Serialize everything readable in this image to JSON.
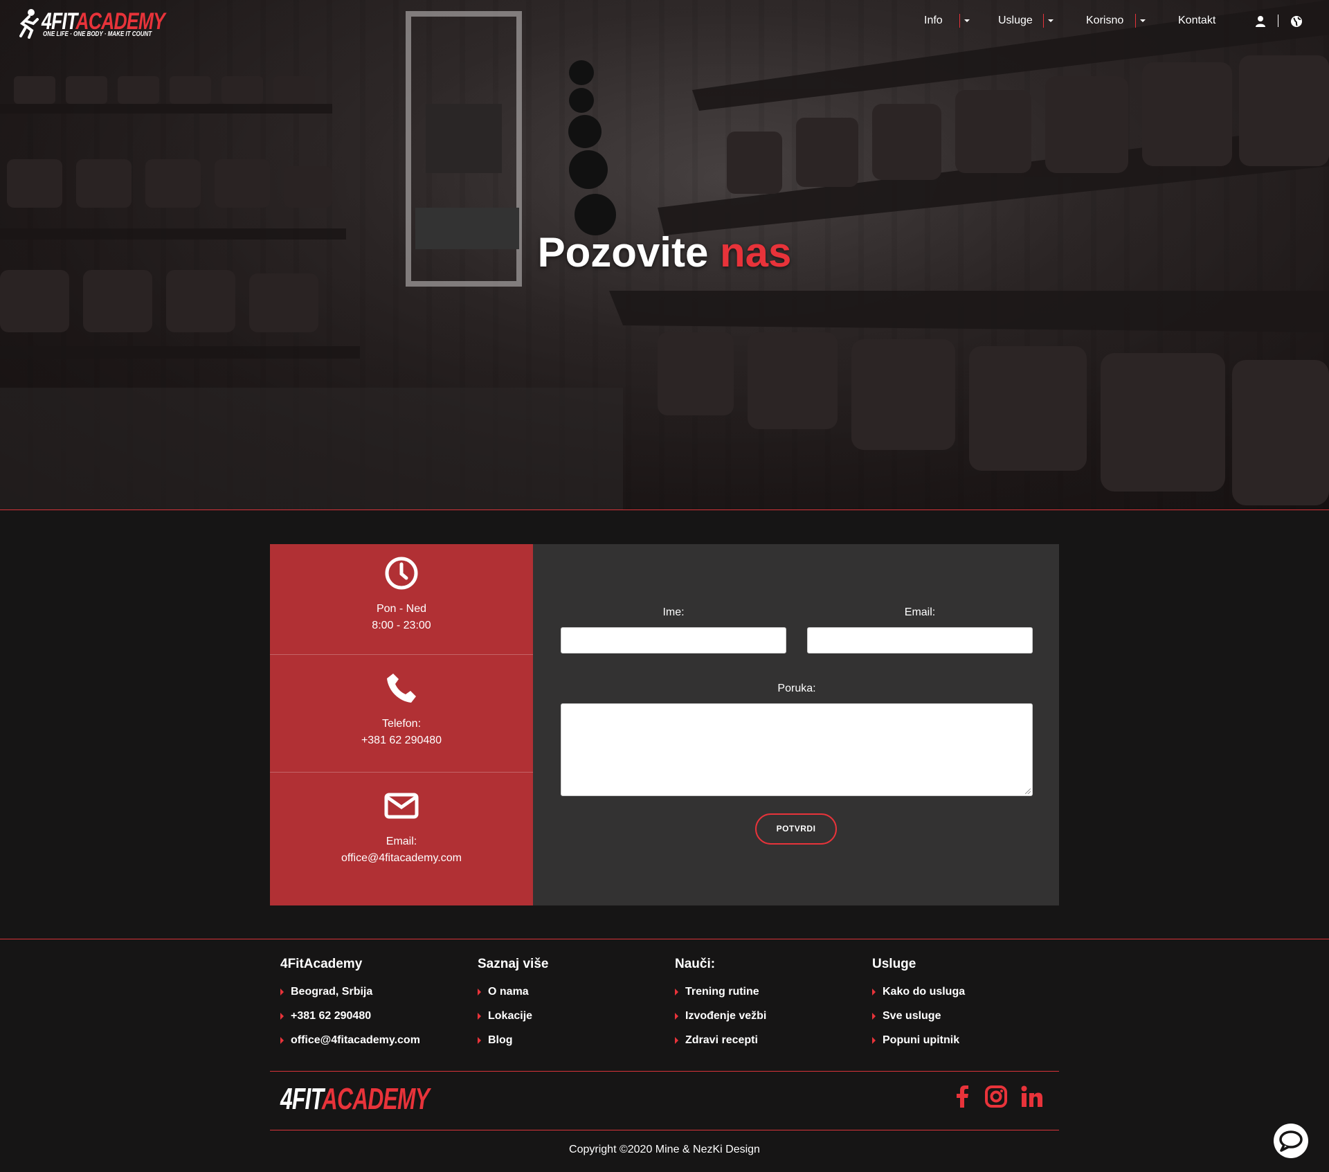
{
  "brand": {
    "logo_white": "4FIT",
    "logo_red": "ACADEMY",
    "tagline": "ONE LIFE · ONE BODY · MAKE IT COUNT"
  },
  "nav": {
    "items": [
      {
        "label": "Info",
        "has_dropdown": true
      },
      {
        "label": "Usluge",
        "has_dropdown": true
      },
      {
        "label": "Korisno",
        "has_dropdown": true
      },
      {
        "label": "Kontakt",
        "has_dropdown": false
      }
    ],
    "icons": [
      "user-icon",
      "globe-icon"
    ]
  },
  "hero": {
    "title_main": "Pozovite",
    "title_accent": "nas"
  },
  "contact_info": {
    "hours": {
      "icon": "clock-icon",
      "line1": "Pon - Ned",
      "line2": "8:00 - 23:00"
    },
    "phone": {
      "icon": "phone-icon",
      "line1": "Telefon:",
      "line2": "+381 62 290480"
    },
    "email": {
      "icon": "envelope-icon",
      "line1": "Email:",
      "line2": "office@4fitacademy.com"
    }
  },
  "form": {
    "name_label": "Ime:",
    "name_value": "",
    "email_label": "Email:",
    "email_value": "",
    "message_label": "Poruka:",
    "message_value": "",
    "submit_label": "POTVRDI"
  },
  "footer": {
    "columns": [
      {
        "title": "4FitAcademy",
        "items": [
          "Beograd, Srbija",
          "+381 62 290480",
          "office@4fitacademy.com"
        ]
      },
      {
        "title": "Saznaj više",
        "items": [
          "O nama",
          "Lokacije",
          "Blog"
        ]
      },
      {
        "title": "Nauči:",
        "items": [
          "Trening rutine",
          "Izvođenje vežbi",
          "Zdravi recepti"
        ]
      },
      {
        "title": "Usluge",
        "items": [
          "Kako do usluga",
          "Sve usluge",
          "Popuni upitnik"
        ]
      }
    ],
    "logo_white": "4FIT",
    "logo_red": "ACADEMY",
    "social": [
      "facebook-icon",
      "instagram-icon",
      "linkedin-icon"
    ],
    "copyright": "Copyright ©2020 Mine & NezKi Design"
  },
  "colors": {
    "accent": "#e8333a",
    "info_panel": "#b13034",
    "form_panel": "#333232",
    "page_bg": "#161515"
  }
}
